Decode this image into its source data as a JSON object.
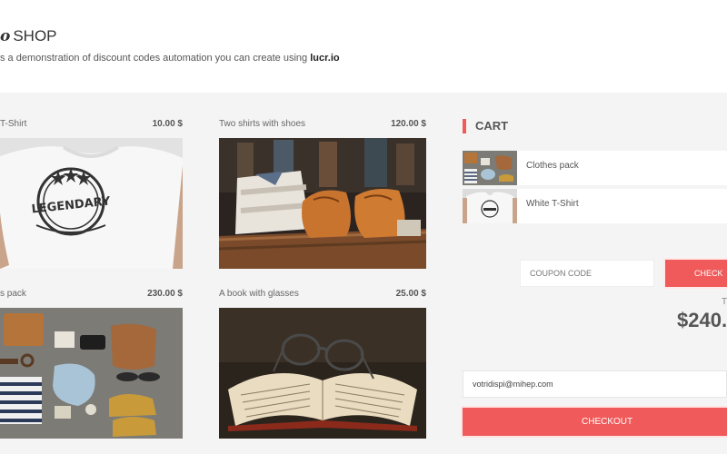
{
  "header": {
    "logo_text": "o",
    "title": "SHOP",
    "tagline_prefix": "s a demonstration of discount codes automation you can create using ",
    "tagline_brand": "lucr.io"
  },
  "products": [
    {
      "name": "T-Shirt",
      "price": "10.00 $"
    },
    {
      "name": "Two shirts with shoes",
      "price": "120.00 $"
    },
    {
      "name": "s pack",
      "price": "230.00 $"
    },
    {
      "name": "A book with glasses",
      "price": "25.00 $"
    }
  ],
  "cart": {
    "title": "CART",
    "items": [
      {
        "name": "Clothes pack"
      },
      {
        "name": "White T-Shirt"
      }
    ],
    "coupon_placeholder": "COUPON CODE",
    "check_label": "CHECK",
    "total_label": "T",
    "total_value": "$240.",
    "email_value": "votridispi@mihep.com",
    "checkout_label": "CHECKOUT"
  },
  "colors": {
    "accent": "#f05a5a",
    "background": "#f4f4f4"
  }
}
